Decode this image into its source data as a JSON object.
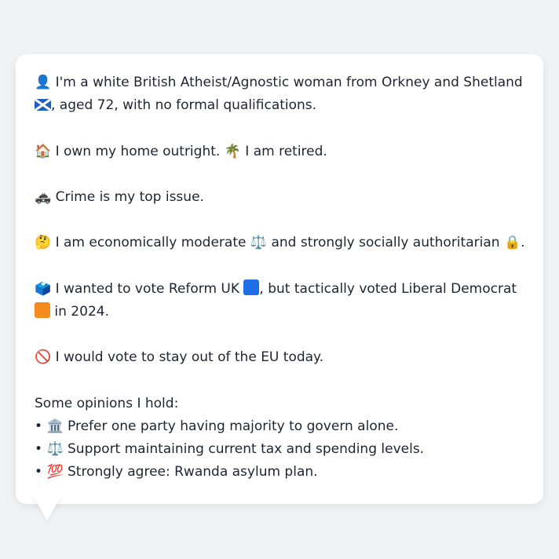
{
  "profile": {
    "identity": {
      "icon": "👤",
      "text": "I'm a white British Atheist/Agnostic woman from Orkney and Shetland",
      "flag_icon": "scotland-flag",
      "text2": ", aged 72, with no formal qualifications."
    },
    "home": {
      "icon": "🏠",
      "text": "I own my home outright.",
      "icon2": "🌴",
      "text2": "I am retired."
    },
    "issue": {
      "icon": "🚓",
      "text": "Crime is my top issue."
    },
    "ideology": {
      "icon": "🤔",
      "text": "I am economically moderate",
      "icon2": "⚖️",
      "text2": "and strongly socially authoritarian",
      "icon3": "🔒",
      "text3": "."
    },
    "vote": {
      "icon": "🗳️",
      "text": "I wanted to vote Reform UK",
      "reform_color": "#1e6fe6",
      "text2": ", but tactically voted Liberal Democrat",
      "libdem_color": "#f58a1f",
      "text3": "in 2024."
    },
    "eu": {
      "icon": "🚫",
      "text": "I would vote to stay out of the EU today."
    },
    "opinions": {
      "heading": "Some opinions I hold:",
      "items": [
        {
          "bullet": "•",
          "icon": "🏛️",
          "text": "Prefer one party having majority to govern alone."
        },
        {
          "bullet": "•",
          "icon": "⚖️",
          "text": "Support maintaining current tax and spending levels."
        },
        {
          "bullet": "•",
          "icon": "💯",
          "text": "Strongly agree: Rwanda asylum plan."
        }
      ]
    }
  }
}
